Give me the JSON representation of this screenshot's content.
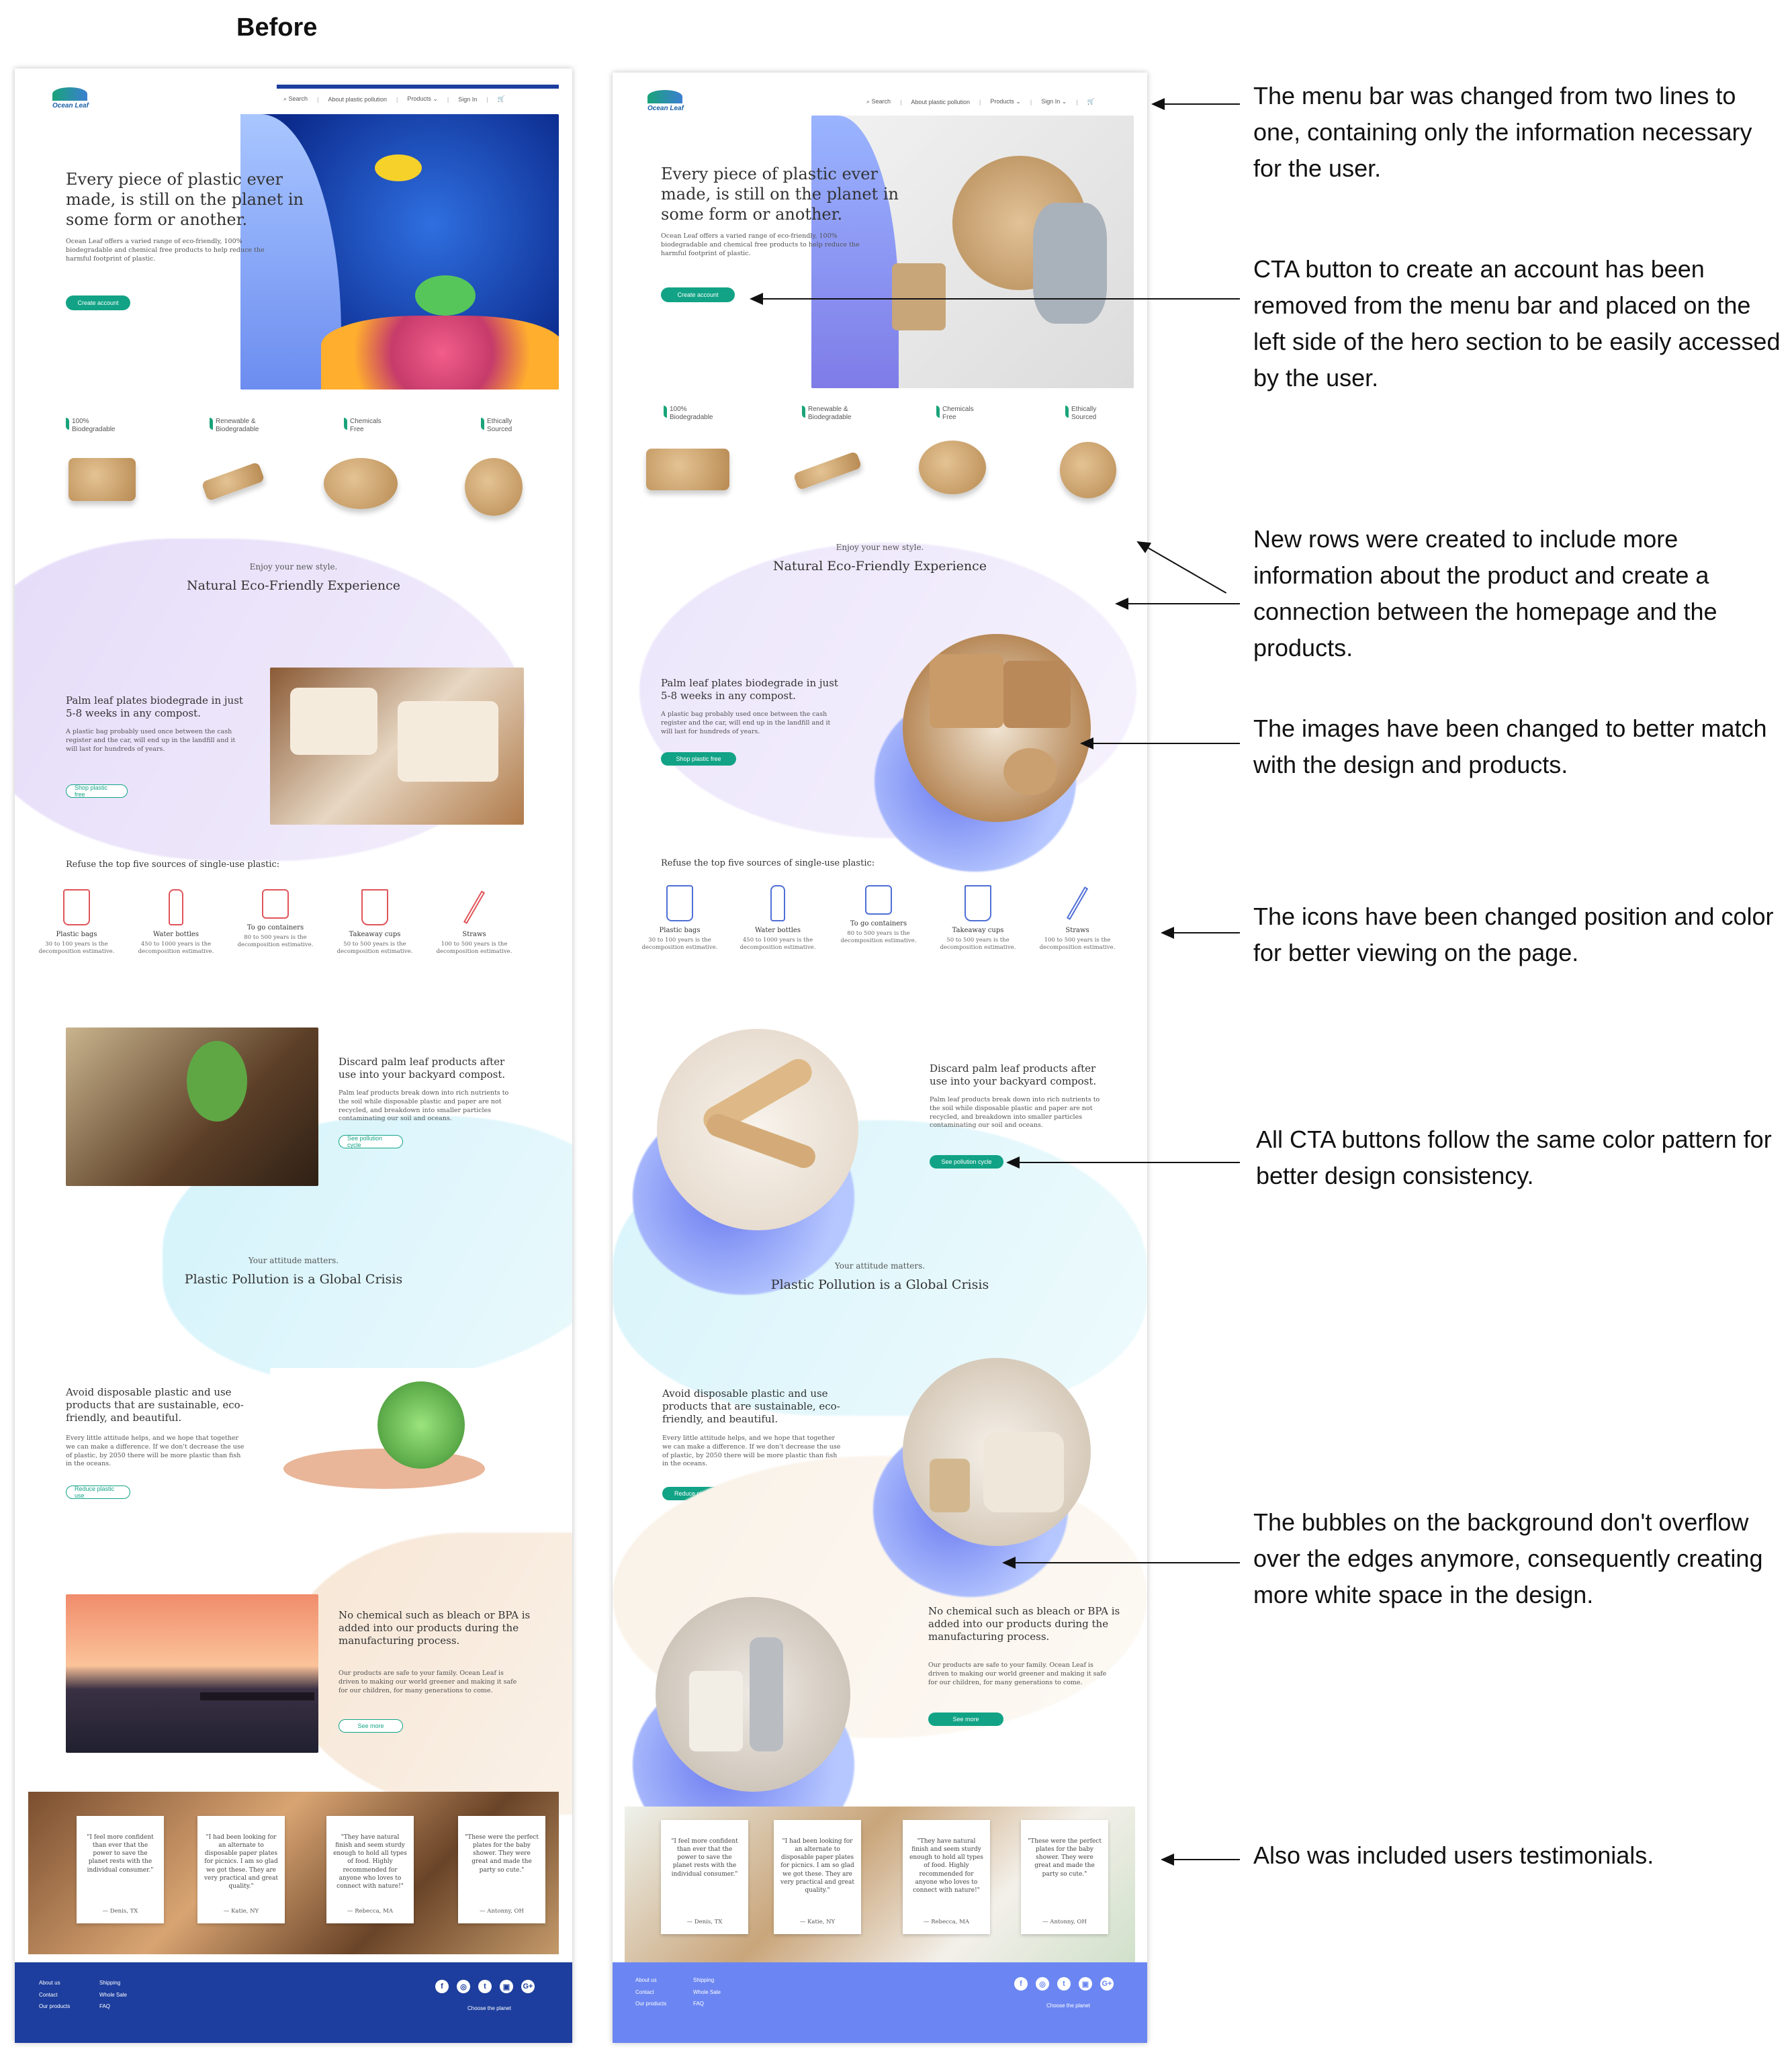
{
  "caption_before": "Before",
  "before": {
    "logo": "Ocean Leaf",
    "nav": {
      "search": "Search",
      "about": "About plastic pollution",
      "products": "Products",
      "signin": "Sign In"
    },
    "hero": {
      "title": "Every piece of plastic ever made, is still on the planet in some form or another.",
      "body": "Ocean Leaf offers a varied range of eco-friendly, 100% biodegradable and chemical free products to help reduce the harmful footprint of plastic.",
      "cta": "Create account"
    },
    "features": [
      "100% Biodegradable",
      "Renewable & Biodegradable",
      "Chemicals Free",
      "Ethically Sourced"
    ],
    "enjoy": {
      "kicker": "Enjoy your new style.",
      "title": "Natural Eco-Friendly Experience"
    },
    "palm": {
      "title": "Palm leaf plates biodegrade in just 5-8 weeks in any compost.",
      "body": "A plastic bag probably used once between the cash register and the car, will end up in the landfill and it will last for hundreds of years.",
      "cta": "Shop plastic free"
    },
    "refuse_title": "Refuse the top five sources of single-use plastic:",
    "sources": [
      {
        "label": "Plastic bags",
        "sub": "30 to 100 years is the decomposition estimative."
      },
      {
        "label": "Water bottles",
        "sub": "450 to 1000 years is the decomposition estimative."
      },
      {
        "label": "To go containers",
        "sub": "80 to 500 years is the decomposition estimative."
      },
      {
        "label": "Takeaway cups",
        "sub": "50 to 500 years is the decomposition estimative."
      },
      {
        "label": "Straws",
        "sub": "100 to 500 years is the decomposition estimative."
      }
    ],
    "discard": {
      "title": "Discard palm leaf products after use into your backyard compost.",
      "body": "Palm leaf products break down into rich nutrients to the soil while disposable plastic and paper are not recycled, and breakdown into smaller particles contaminating our soil and oceans.",
      "cta": "See pollution cycle"
    },
    "attitude": {
      "kicker": "Your attitude matters.",
      "title": "Plastic Pollution is a Global Crisis"
    },
    "avoid": {
      "title": "Avoid disposable plastic and use products that are sustainable, eco-friendly, and beautiful.",
      "body": "Every little attitude helps, and we hope that together we can make a difference. If we don't decrease the use of plastic, by 2050 there will be more plastic than fish in the oceans.",
      "cta": "Reduce plastic use"
    },
    "chemical": {
      "title": "No chemical such as bleach or BPA is added into our products during the manufacturing process.",
      "body": "Our products are safe to your family. Ocean Leaf is driven to making our world greener and making it safe for our children, for many generations to come.",
      "cta": "See more"
    },
    "testimonials": [
      {
        "quote": "\"I feel more confident than ever that the power to save the planet rests with the individual consumer.\"",
        "author": "— Denis, TX"
      },
      {
        "quote": "\"I had been looking for an alternate to disposable paper plates for picnics. I am so glad we got these. They are very practical and great quality.\"",
        "author": "— Katie, NY"
      },
      {
        "quote": "\"They have natural finish and seem sturdy enough to hold all types of food. Highly recommended for anyone who loves to connect with nature!\"",
        "author": "— Rebecca, MA"
      },
      {
        "quote": "\"These were the perfect plates for the baby shower. They were great and made the party so cute.\"",
        "author": "— Antonny, OH"
      }
    ],
    "footer": {
      "links1": [
        "About us",
        "Contact",
        "Our products"
      ],
      "links2": [
        "Shipping",
        "Whole Sale",
        "FAQ"
      ],
      "tagline": "Choose the planet",
      "social": [
        "f",
        "◎",
        "t",
        "▣",
        "G+"
      ]
    }
  },
  "after": {
    "palm_title": "Palm leaf plates biodegrade in just 5-8 weeks in any compost."
  },
  "annotations": [
    "The menu bar was changed from two lines to one, containing only the information necessary for the user.",
    "CTA button to create an account has been removed from the menu bar and placed on the left side of the hero section to be easily accessed by the user.",
    "New rows were created to include more information about the product and create a connection between the homepage and the products.",
    "The images have been changed to better match with the design and products.",
    "The icons have been changed position and color for better viewing on the page.",
    "All CTA buttons follow the same color pattern for better design consistency.",
    "The bubbles on the background don't overflow over the edges anymore, consequently creating more white space in the design.",
    "Also was included users testimonials."
  ],
  "colors": {
    "accent": "#12a386",
    "before_icons": "#e0555a",
    "after_icons": "#4f6fd6",
    "footer_before": "#1d3e9e",
    "footer_after": "#6b86f2"
  }
}
